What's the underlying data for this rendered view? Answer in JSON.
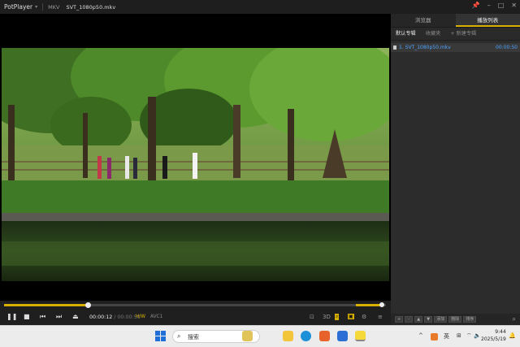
{
  "titlebar": {
    "app_name": "PotPlayer",
    "format": "MKV",
    "file_name": "SVT_1080p50.mkv"
  },
  "panel": {
    "tabs": [
      {
        "label": "浏览器",
        "active": false
      },
      {
        "label": "播放列表",
        "active": true
      }
    ],
    "subtabs": [
      {
        "label": "默认专辑",
        "active": true
      },
      {
        "label": "收藏夹",
        "active": false
      },
      {
        "label": "+ 新建专辑",
        "active": false
      }
    ],
    "items": [
      {
        "name": "1. SVT_1080p50.mkv",
        "duration": "00:00:50"
      }
    ],
    "bottom_buttons": [
      "+",
      "-",
      "▲",
      "▼",
      "添加",
      "删除",
      "排序"
    ]
  },
  "controls": {
    "current_time": "00:00:12",
    "duration": "/ 00:00:50",
    "hw_badge": "H/W",
    "codec": "AVC1",
    "seek_progress": 0.22,
    "volume_level": 0.9
  },
  "taskbar": {
    "search_placeholder": "搜索",
    "ime": "英",
    "time": "9:44",
    "date": "2025/5/19"
  },
  "colors": {
    "accent": "#d8b000",
    "playlist_link": "#4da3ff",
    "windows_blue": "#1f6fd6"
  }
}
